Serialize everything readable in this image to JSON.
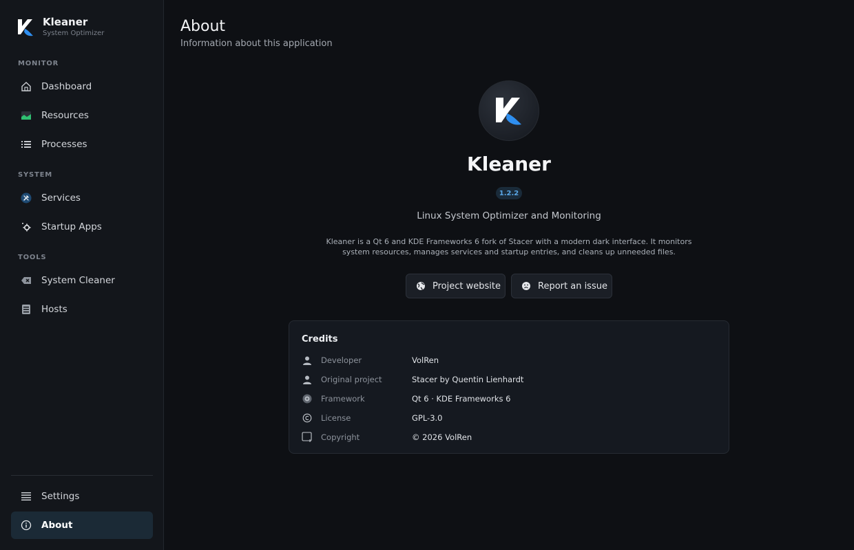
{
  "sidebar": {
    "brand": {
      "name": "Kleaner",
      "subtitle": "System Optimizer"
    },
    "sections": {
      "monitor": "MONITOR",
      "system": "SYSTEM",
      "tools": "TOOLS"
    },
    "items": {
      "dashboard": {
        "label": "Dashboard",
        "icon": "home-icon"
      },
      "resources": {
        "label": "Resources",
        "icon": "chart-area-icon"
      },
      "processes": {
        "label": "Processes",
        "icon": "list-icon"
      },
      "services": {
        "label": "Services",
        "icon": "tools-icon"
      },
      "startup": {
        "label": "Startup Apps",
        "icon": "gear-icon"
      },
      "cleaner": {
        "label": "System Cleaner",
        "icon": "clear-icon"
      },
      "hosts": {
        "label": "Hosts",
        "icon": "server-icon"
      },
      "settings": {
        "label": "Settings",
        "icon": "menu-icon"
      },
      "about": {
        "label": "About",
        "icon": "info-icon",
        "active": true
      }
    }
  },
  "header": {
    "title": "About",
    "subtitle": "Information about this application"
  },
  "about": {
    "app_name": "Kleaner",
    "version": "1.2.2",
    "tagline": "Linux System Optimizer and Monitoring",
    "description": "Kleaner is a Qt 6 and KDE Frameworks 6 fork of Stacer with a modern dark interface. It monitors system resources, manages services and startup entries, and cleans up unneeded files.",
    "buttons": {
      "website": "Project website",
      "issue": "Report an issue"
    }
  },
  "credits": {
    "title": "Credits",
    "rows": [
      {
        "label": "Developer",
        "value": "VolRen",
        "icon": "user-icon"
      },
      {
        "label": "Original project",
        "value": "Stacer by Quentin Lienhardt",
        "icon": "user-icon"
      },
      {
        "label": "Framework",
        "value": "Qt 6 · KDE Frameworks 6",
        "icon": "cog-icon"
      },
      {
        "label": "License",
        "value": "GPL-3.0",
        "icon": "copyright-icon"
      },
      {
        "label": "Copyright",
        "value": "© 2026 VolRen",
        "icon": "window-icon"
      }
    ]
  },
  "colors": {
    "accent": "#2f8ff0",
    "active_bg": "#1b2a36",
    "background": "#0e1014"
  }
}
